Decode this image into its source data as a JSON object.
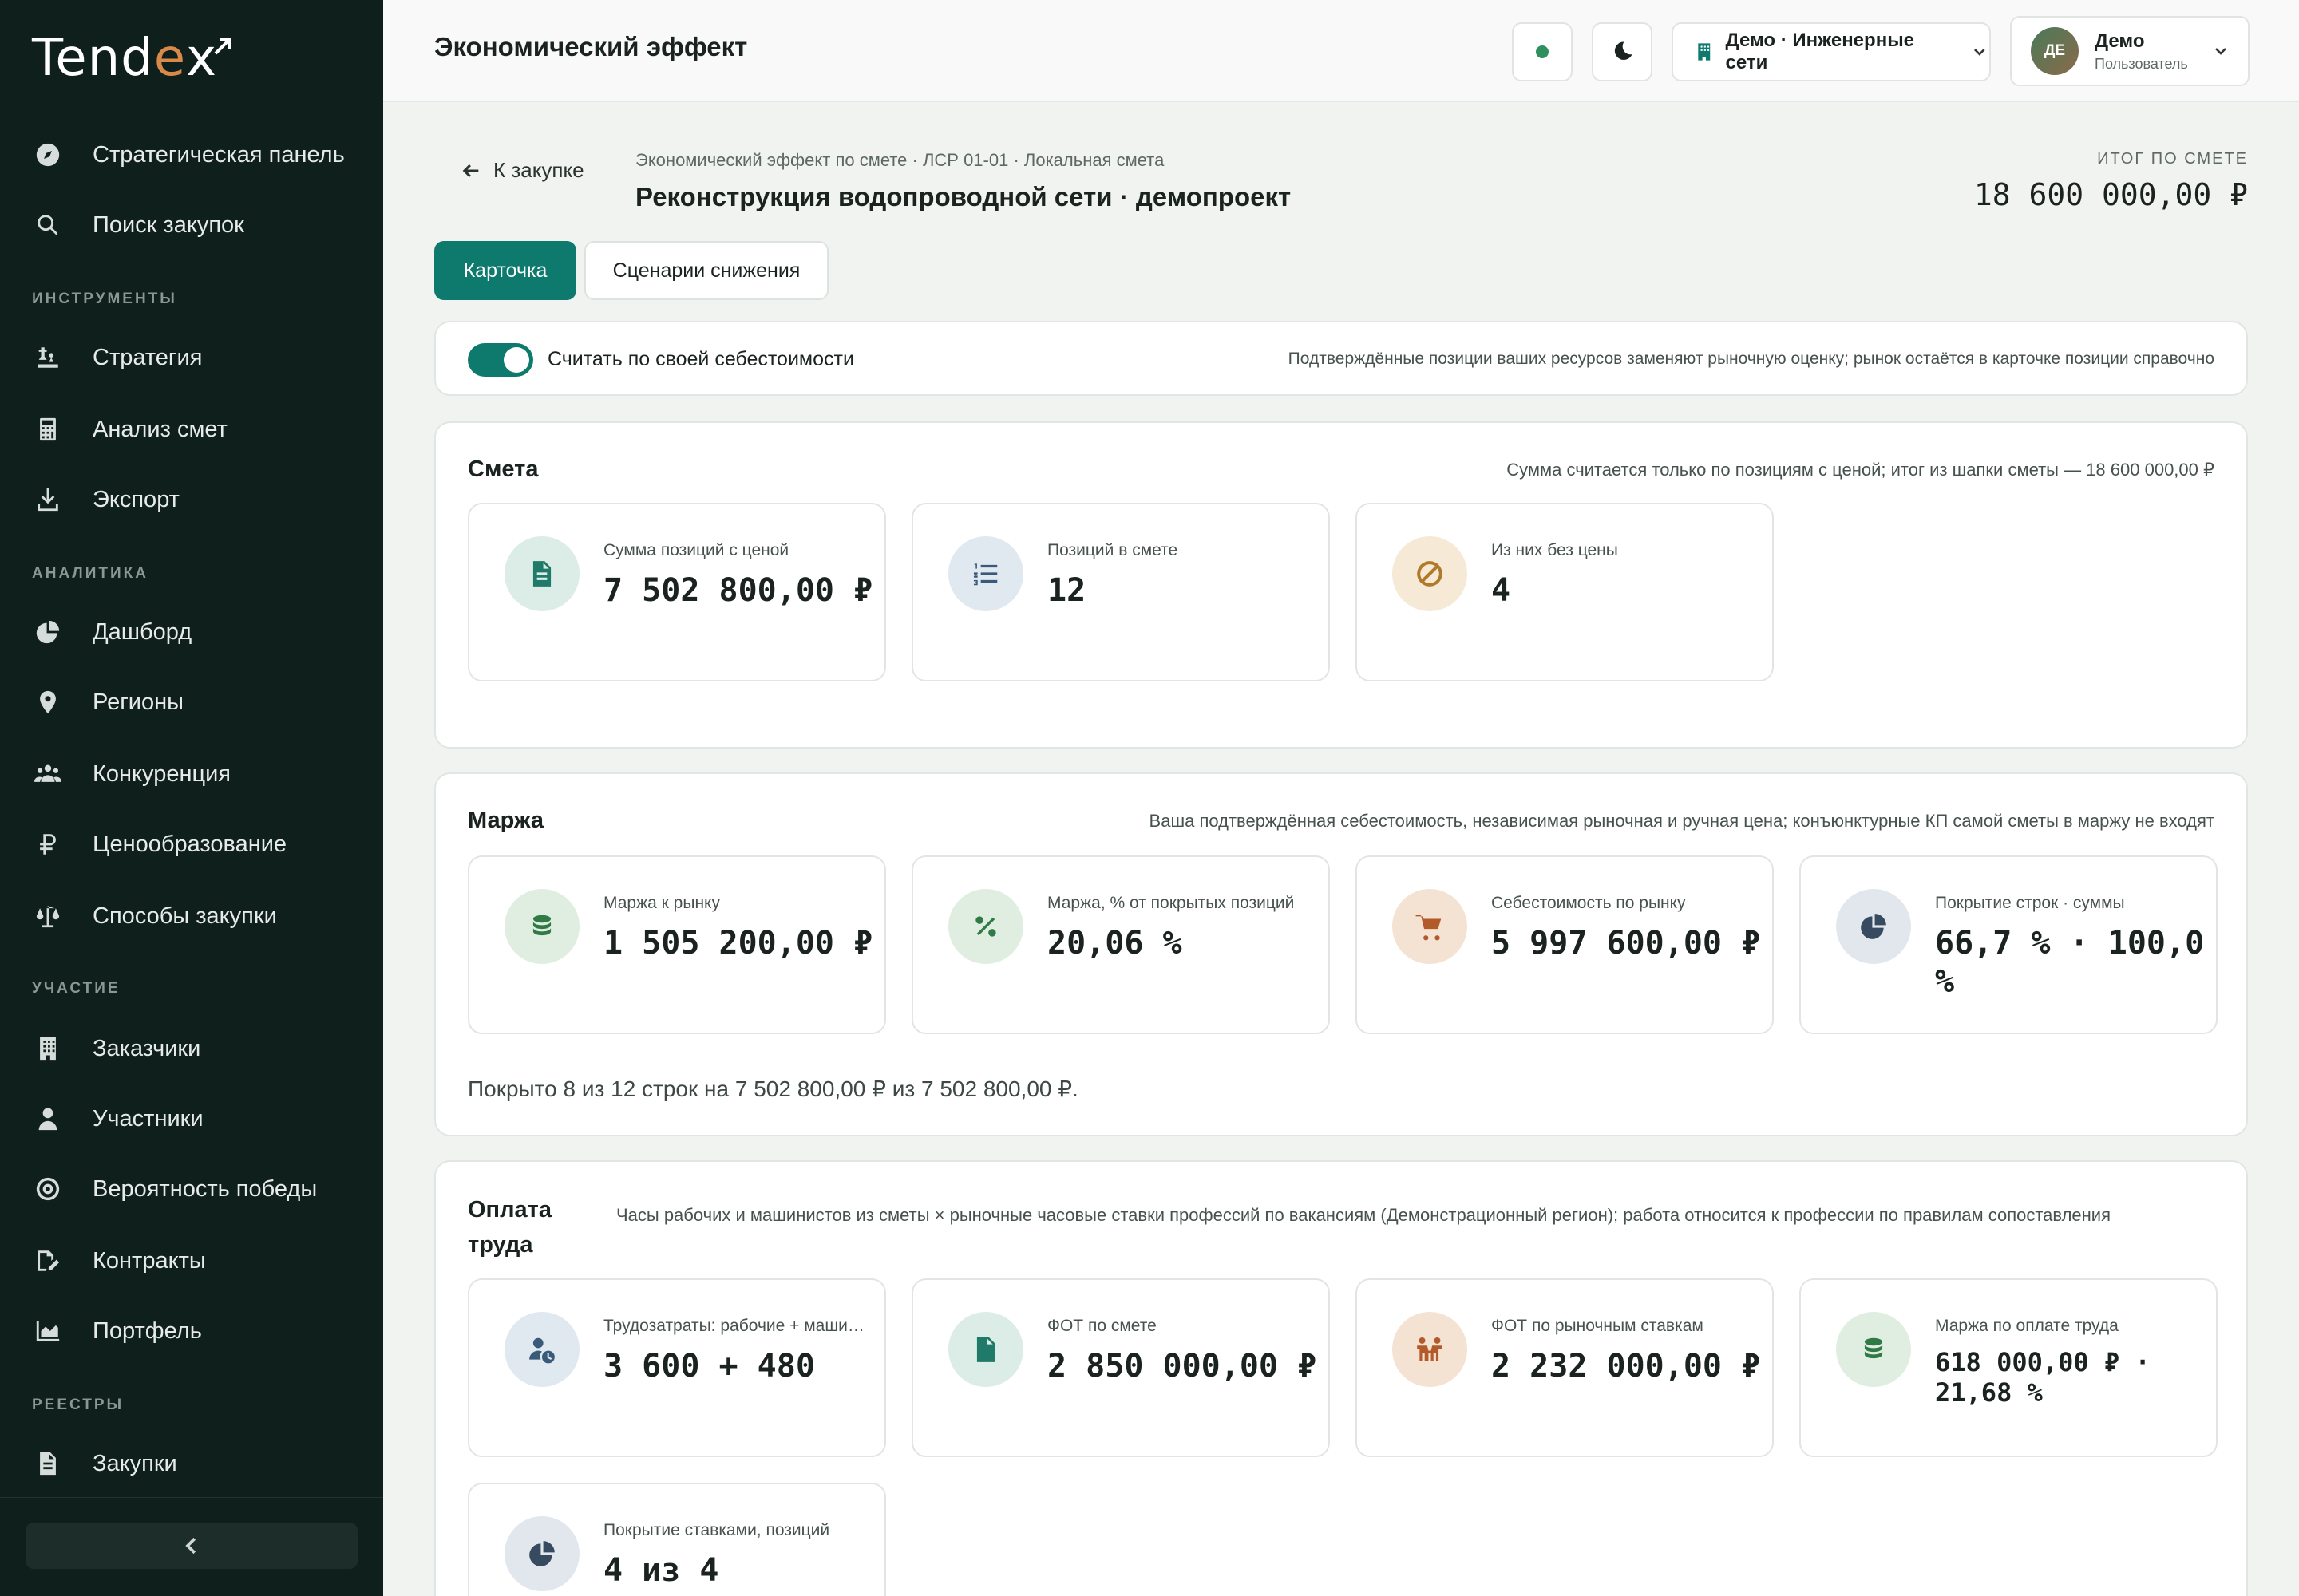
{
  "app": {
    "logo_main": "Tend",
    "logo_accent": "e",
    "logo_end": "x"
  },
  "sidebar": {
    "items_top": [
      {
        "label": "Стратегическая панель",
        "icon": "compass-icon"
      },
      {
        "label": "Поиск закупок",
        "icon": "search-icon"
      }
    ],
    "sections": [
      {
        "title": "ИНСТРУМЕНТЫ",
        "items": [
          {
            "label": "Стратегия",
            "icon": "chess-icon"
          },
          {
            "label": "Анализ смет",
            "icon": "calculator-icon"
          },
          {
            "label": "Экспорт",
            "icon": "download-icon"
          }
        ]
      },
      {
        "title": "АНАЛИТИКА",
        "items": [
          {
            "label": "Дашборд",
            "icon": "pie-chart-icon"
          },
          {
            "label": "Регионы",
            "icon": "map-pin-icon"
          },
          {
            "label": "Конкуренция",
            "icon": "users-icon"
          },
          {
            "label": "Ценообразование",
            "icon": "ruble-icon"
          },
          {
            "label": "Способы закупки",
            "icon": "scales-icon"
          }
        ]
      },
      {
        "title": "УЧАСТИЕ",
        "items": [
          {
            "label": "Заказчики",
            "icon": "building-icon"
          },
          {
            "label": "Участники",
            "icon": "user-icon"
          },
          {
            "label": "Вероятность победы",
            "icon": "target-icon"
          },
          {
            "label": "Контракты",
            "icon": "signature-icon"
          },
          {
            "label": "Портфель",
            "icon": "area-chart-icon"
          }
        ]
      },
      {
        "title": "РЕЕСТРЫ",
        "items": [
          {
            "label": "Закупки",
            "icon": "file-invoice-icon"
          }
        ]
      }
    ]
  },
  "header": {
    "title": "Экономический эффект",
    "org": "Демо · Инженерные сети",
    "user": {
      "initials": "ДЕ",
      "name": "Демо",
      "role": "Пользователь"
    }
  },
  "page": {
    "back": "К закупке",
    "breadcrumb": "Экономический эффект по смете · ЛСР 01-01 · Локальная смета",
    "title": "Реконструкция водопроводной сети · демопроект",
    "total_label": "ИТОГ ПО СМЕТЕ",
    "total_value": "18 600 000,00 ₽",
    "tabs": [
      {
        "label": "Карточка"
      },
      {
        "label": "Сценарии снижения"
      }
    ],
    "toggle": {
      "label": "Считать по своей себестоимости",
      "note": "Подтверждённые позиции ваших ресурсов заменяют рыночную оценку; рынок остаётся в карточке позиции справочно",
      "on": true
    }
  },
  "estimate": {
    "title": "Смета",
    "note": "Сумма считается только по позициям с ценой; итог из шапки сметы — 18 600 000,00 ₽",
    "cards": [
      {
        "label": "Сумма позиций с ценой",
        "value": "7 502 800,00 ₽",
        "icon": "file-icon",
        "tone": "teal"
      },
      {
        "label": "Позиций в смете",
        "value": "12",
        "icon": "list-ol-icon",
        "tone": "blue"
      },
      {
        "label": "Из них без цены",
        "value": "4",
        "icon": "ban-icon",
        "tone": "amber"
      }
    ]
  },
  "margin": {
    "title": "Маржа",
    "note": "Ваша подтверждённая себестоимость, независимая рыночная и ручная цена; конъюнктурные КП самой сметы в маржу не входят",
    "cards": [
      {
        "label": "Маржа к рынку",
        "value": "1 505 200,00 ₽",
        "icon": "coins-icon",
        "tone": "green"
      },
      {
        "label": "Маржа, % от покрытых позиций",
        "value": "20,06 %",
        "icon": "percent-icon",
        "tone": "green"
      },
      {
        "label": "Себестоимость по рынку",
        "value": "5 997 600,00 ₽",
        "icon": "cart-icon",
        "tone": "orange"
      },
      {
        "label": "Покрытие строк · суммы",
        "value": "66,7 % · 100,0 %",
        "icon": "pie-chart-icon",
        "tone": "slate"
      }
    ],
    "coverage": "Покрыто 8 из 12 строк на 7 502 800,00 ₽ из 7 502 800,00 ₽."
  },
  "labor": {
    "title_line1": "Оплата",
    "title_line2": "труда",
    "note": "Часы рабочих и машинистов из сметы × рыночные часовые ставки профессий по вакансиям (Демонстрационный регион); работа относится к профессии по правилам сопоставления",
    "cards": [
      {
        "label": "Трудозатраты: рабочие + машинисты",
        "value": "3 600 + 480",
        "icon": "user-clock-icon",
        "tone": "blue"
      },
      {
        "label": "ФОТ по смете",
        "value": "2 850 000,00 ₽",
        "icon": "file-dollar-icon",
        "tone": "teal"
      },
      {
        "label": "ФОТ по рыночным ставкам",
        "value": "2 232 000,00 ₽",
        "icon": "workers-icon",
        "tone": "orange"
      },
      {
        "label": "Маржа по оплате труда",
        "value": "618 000,00 ₽ · 21,68 %",
        "icon": "coins-icon",
        "tone": "green"
      },
      {
        "label": "Покрытие ставками, позиций",
        "value": "4 из 4",
        "icon": "pie-chart-icon",
        "tone": "slate"
      }
    ]
  }
}
